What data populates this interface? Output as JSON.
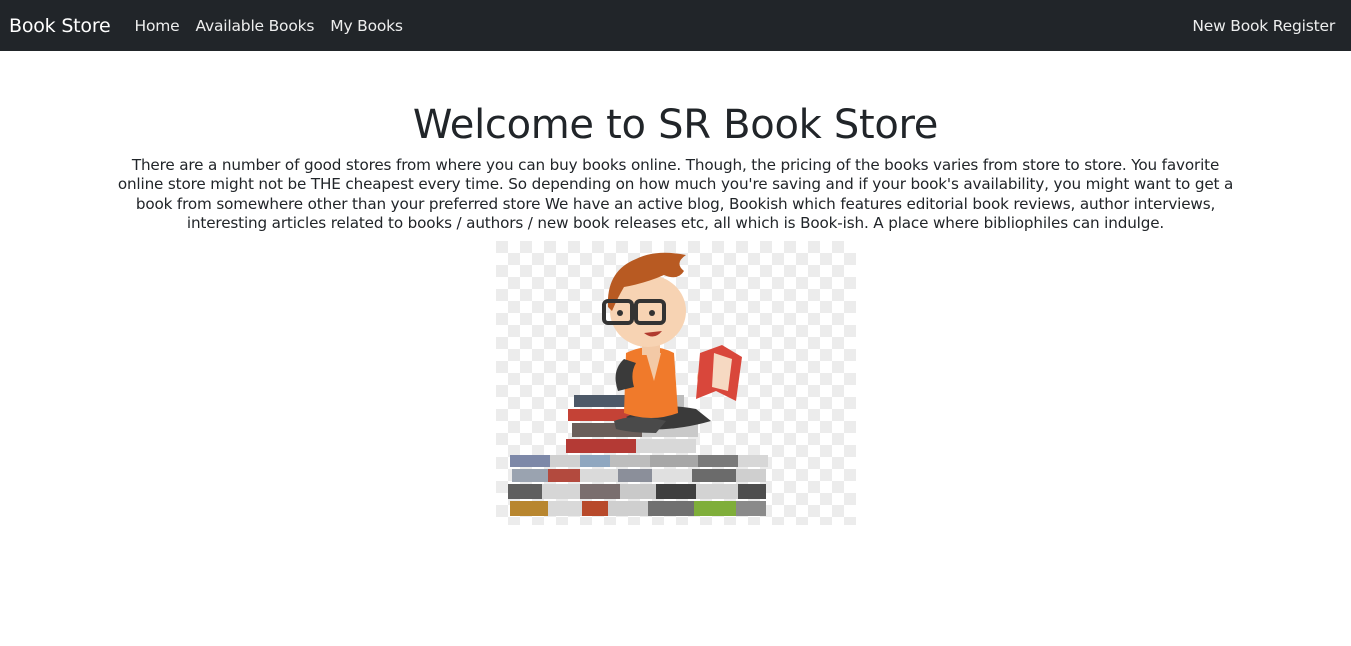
{
  "navbar": {
    "brand": "Book Store",
    "links": [
      "Home",
      "Available Books",
      "My Books"
    ],
    "right_link": "New Book Register",
    "background": "#212529"
  },
  "main": {
    "title": "Welcome to SR Book Store",
    "intro": "There are a number of good stores from where you can buy books online. Though, the pricing of the books varies from store to store. You favorite online store might not be THE cheapest every time. So depending on how much you're saving and if your book's availability, you might want to get a book from somewhere other than your preferred store We have an active blog, Bookish which features editorial book reviews, author interviews, interesting articles related to books / authors / new book releases etc, all which is Book-ish. A place where bibliophiles can indulge.",
    "hero_image": "boy-reading-on-book-stack-illustration"
  }
}
